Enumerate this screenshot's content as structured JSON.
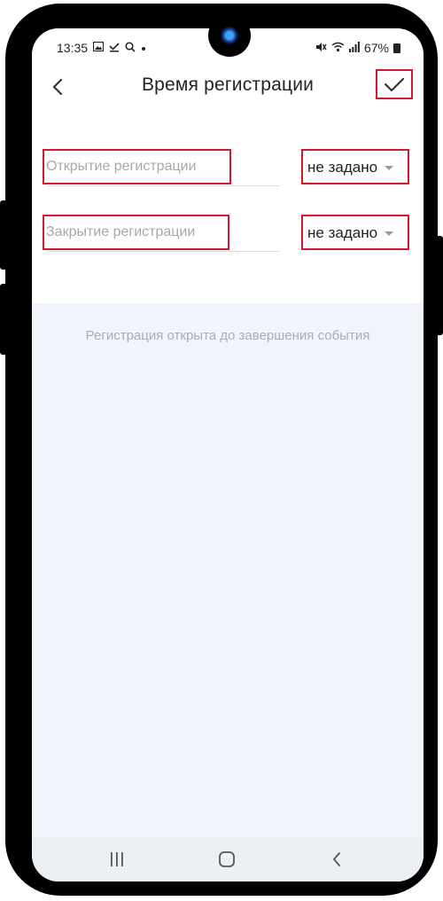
{
  "status_bar": {
    "time": "13:35",
    "battery": "67%"
  },
  "app_bar": {
    "title": "Время регистрации"
  },
  "fields": [
    {
      "label": "Открытие регистрации",
      "value": "не задано"
    },
    {
      "label": "Закрытие регистрации",
      "value": "не задано"
    }
  ],
  "info_text": "Регистрация открыта до завершения события",
  "colors": {
    "highlight": "#d3172f",
    "background": "#f1f5fb",
    "label_gray": "#a8a8a8"
  },
  "icons": {
    "back": "back-arrow-icon",
    "confirm": "check-icon",
    "nav": [
      "recent-apps-icon",
      "home-icon",
      "nav-back-icon"
    ]
  }
}
